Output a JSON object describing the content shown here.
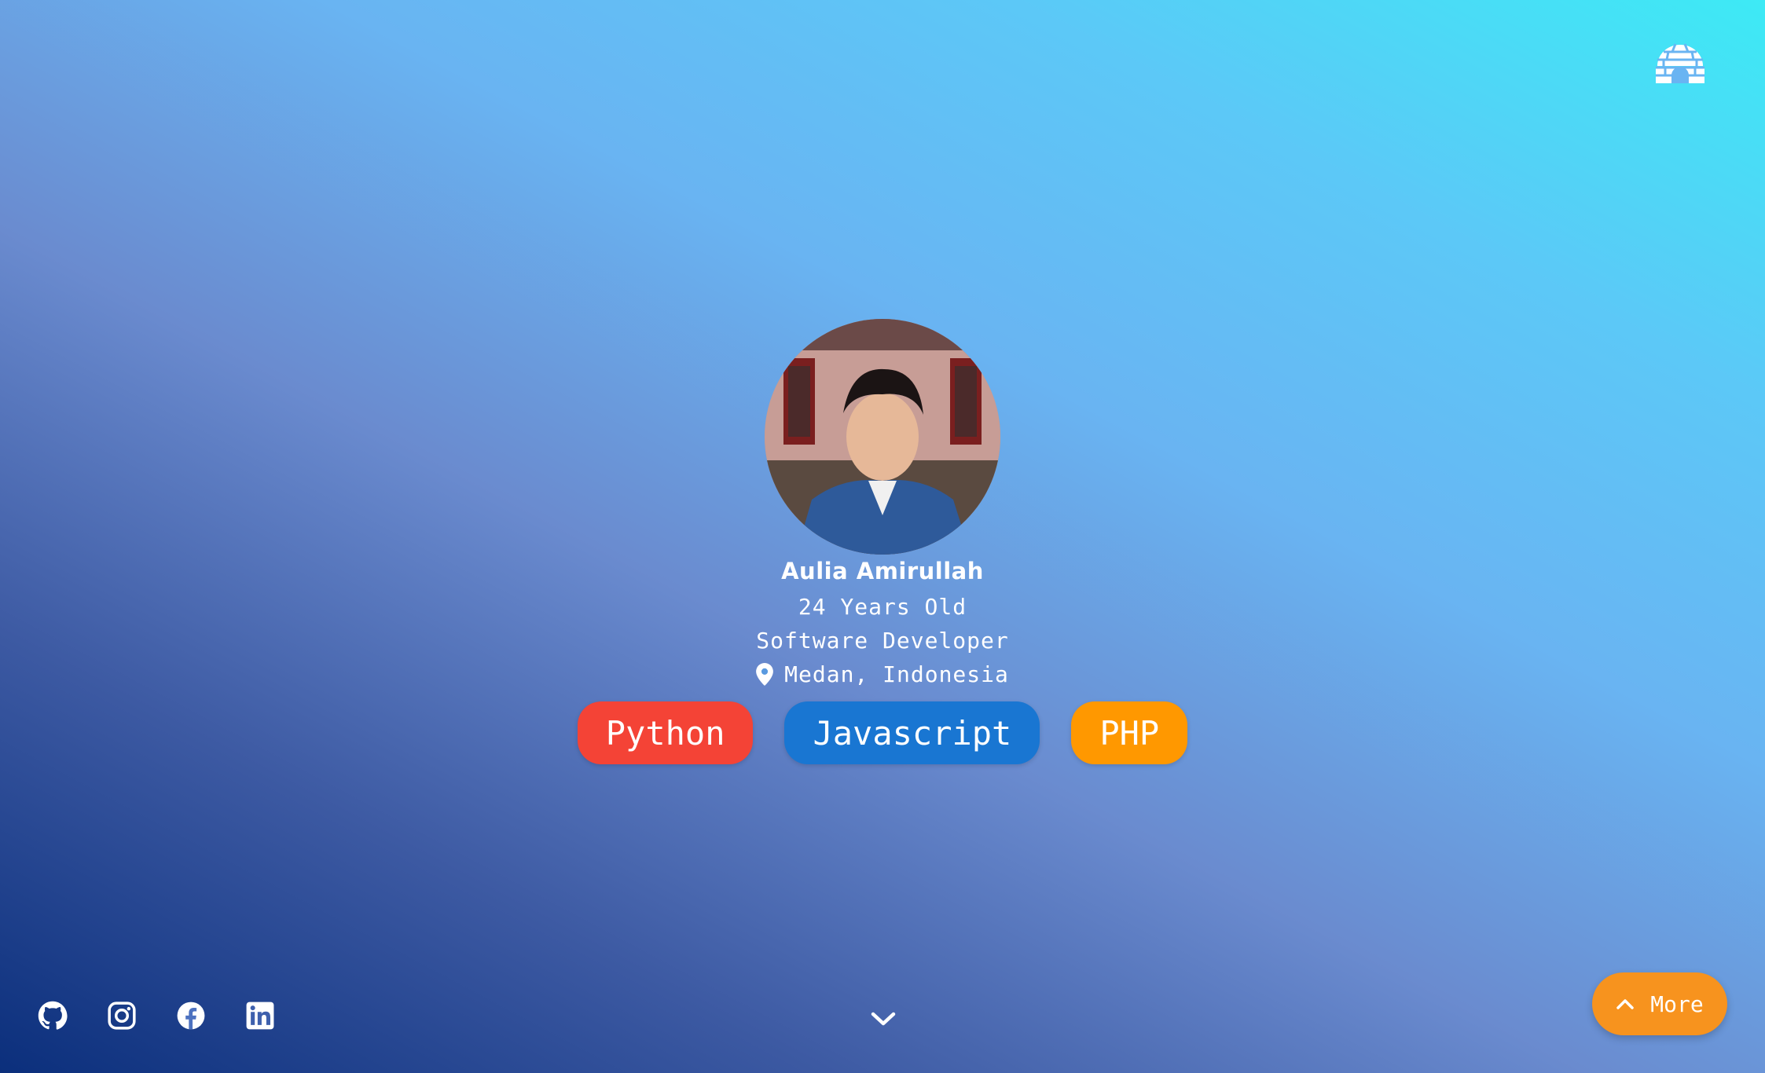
{
  "profile": {
    "name": "Aulia Amirullah",
    "age": "24 Years Old",
    "role": "Software Developer",
    "location": "Medan, Indonesia"
  },
  "skills": [
    {
      "label": "Python",
      "color": "#f44336"
    },
    {
      "label": "Javascript",
      "color": "#1976d2"
    },
    {
      "label": "PHP",
      "color": "#ff9800"
    }
  ],
  "icons": {
    "logo": "igloo-icon",
    "location": "map-pin-icon",
    "scroll": "chevron-down-icon",
    "more": "chevron-up-icon",
    "social": [
      "github-icon",
      "instagram-icon",
      "facebook-icon",
      "linkedin-icon"
    ]
  },
  "more_button": {
    "label": "More",
    "color": "#f7931e"
  }
}
